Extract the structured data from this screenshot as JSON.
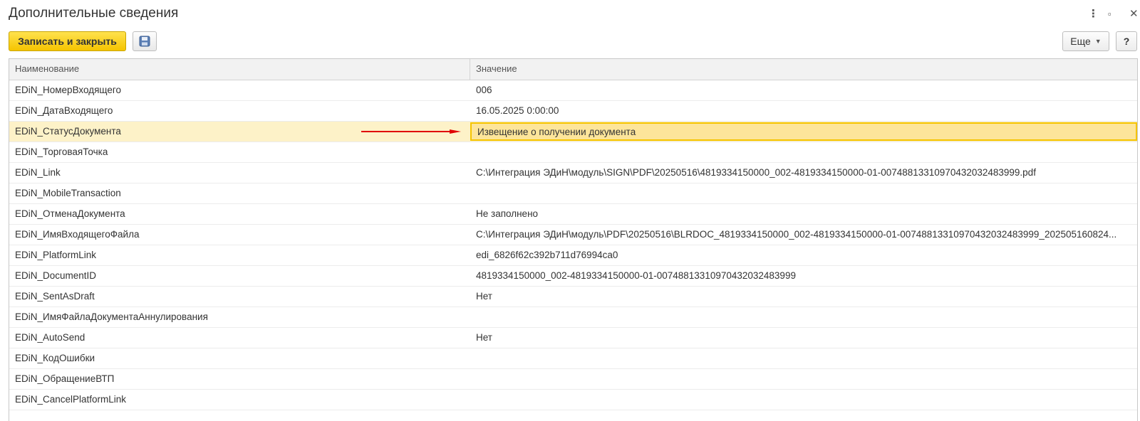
{
  "window": {
    "title": "Дополнительные сведения",
    "more_glyph": "⋮",
    "maximize_glyph": "▫",
    "close_glyph": "✕"
  },
  "toolbar": {
    "save_close_label": "Записать и закрыть",
    "more_label": "Еще",
    "help_label": "?"
  },
  "table": {
    "columns": [
      "Наименование",
      "Значение"
    ],
    "rows": [
      {
        "name": "EDiN_НомерВходящего",
        "value": "006"
      },
      {
        "name": "EDiN_ДатаВходящего",
        "value": "16.05.2025 0:00:00"
      },
      {
        "name": "EDiN_СтатусДокумента",
        "value": "Извещение о получении документа"
      },
      {
        "name": "EDiN_ТорговаяТочка",
        "value": ""
      },
      {
        "name": "EDiN_Link",
        "value": "C:\\Интеграция ЭДиН\\модуль\\SIGN\\PDF\\20250516\\4819334150000_002-4819334150000-01-00748813310970432032483999.pdf"
      },
      {
        "name": "EDiN_MobileTransaction",
        "value": ""
      },
      {
        "name": "EDiN_ОтменаДокумента",
        "value": "Не заполнено"
      },
      {
        "name": "EDiN_ИмяВходящегоФайла",
        "value": "C:\\Интеграция ЭДиН\\модуль\\PDF\\20250516\\BLRDOC_4819334150000_002-4819334150000-01-00748813310970432032483999_202505160824..."
      },
      {
        "name": "EDiN_PlatformLink",
        "value": "edi_6826f62c392b711d76994ca0"
      },
      {
        "name": "EDiN_DocumentID",
        "value": "4819334150000_002-4819334150000-01-00748813310970432032483999"
      },
      {
        "name": "EDiN_SentAsDraft",
        "value": "Нет"
      },
      {
        "name": "EDiN_ИмяФайлаДокументаАннулирования",
        "value": ""
      },
      {
        "name": "EDiN_AutoSend",
        "value": "Нет"
      },
      {
        "name": "EDiN_КодОшибки",
        "value": ""
      },
      {
        "name": "EDiN_ОбращениеВТП",
        "value": ""
      },
      {
        "name": "EDiN_CancelPlatformLink",
        "value": ""
      }
    ],
    "selected_row": 2
  },
  "colors": {
    "accent": "#f5c400",
    "selected_row": "#fdf2c8",
    "annotation_arrow": "#e00000"
  }
}
